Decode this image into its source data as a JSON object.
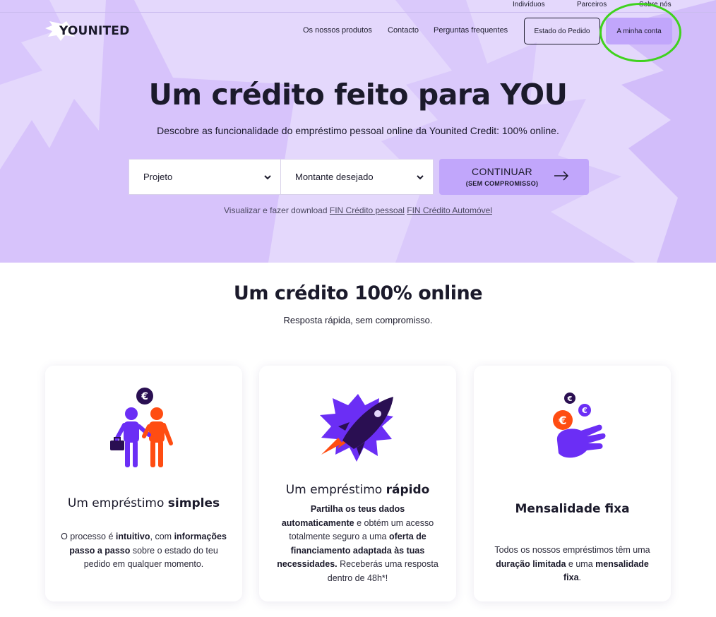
{
  "top_nav": {
    "individuals": "Indivíduos",
    "partners": "Parceiros",
    "about": "Sobre nós"
  },
  "header": {
    "logo_text": "YOUNITED",
    "nav_products": "Os nossos produtos",
    "nav_contact": "Contacto",
    "nav_faq": "Perguntas frequentes",
    "order_status_button": "Estado do Pedido",
    "my_account_button": "A minha conta"
  },
  "hero": {
    "title": "Um crédito feito para YOU",
    "subtitle": "Descobre as funcionalidade do empréstimo pessoal online da Younited Credit: 100% online.",
    "project_select": "Projeto",
    "amount_select": "Montante desejado",
    "continue_label": "CONTINUAR",
    "continue_sub": "(SEM COMPROMISSO)",
    "download_prefix": "Visualizar e fazer download",
    "link_fin_personal": "FIN Crédito pessoal",
    "link_fin_auto": "FIN Crédito Automóvel"
  },
  "section": {
    "title_part1": "Um crédito ",
    "title_bold": "100% online",
    "subtitle": "Resposta rápida, sem compromisso."
  },
  "cards": [
    {
      "icon": "people-euro-icon",
      "title_part1": "Um empréstimo ",
      "title_bold": "simples",
      "text": [
        {
          "t": "O processo é ",
          "b": false
        },
        {
          "t": "intuitivo",
          "b": true
        },
        {
          "t": ", com ",
          "b": false
        },
        {
          "t": "informações passo a passo",
          "b": true
        },
        {
          "t": " sobre o estado do teu pedido em qualquer momento.",
          "b": false
        }
      ]
    },
    {
      "icon": "rocket-icon",
      "title_part1": "Um empréstimo ",
      "title_bold": "rápido",
      "text": [
        {
          "t": "Partilha os teus dados automaticamente",
          "b": true
        },
        {
          "t": " e obtém um acesso totalmente seguro a uma ",
          "b": false
        },
        {
          "t": "oferta de financiamento adaptada às tuas necessidades.",
          "b": true
        },
        {
          "t": " Receberás uma resposta dentro de 48h*!",
          "b": false
        }
      ]
    },
    {
      "icon": "hand-coins-icon",
      "title_part1": "",
      "title_bold": "Mensalidade fixa",
      "text": [
        {
          "t": "Todos os nossos empréstimos têm uma ",
          "b": false
        },
        {
          "t": "duração limitada",
          "b": true
        },
        {
          "t": " e uma ",
          "b": false
        },
        {
          "t": "mensalidade fixa",
          "b": true
        },
        {
          "t": ".",
          "b": false
        }
      ]
    }
  ],
  "colors": {
    "hero_bg": "#e4d8fc",
    "hero_shape": "#cfb8fb",
    "accent_button": "#c1a6fb",
    "annotation_circle": "#3fd21e",
    "icon_purple": "#6b2ef5",
    "icon_orange": "#ff4d12",
    "icon_dark": "#2a0f52"
  }
}
